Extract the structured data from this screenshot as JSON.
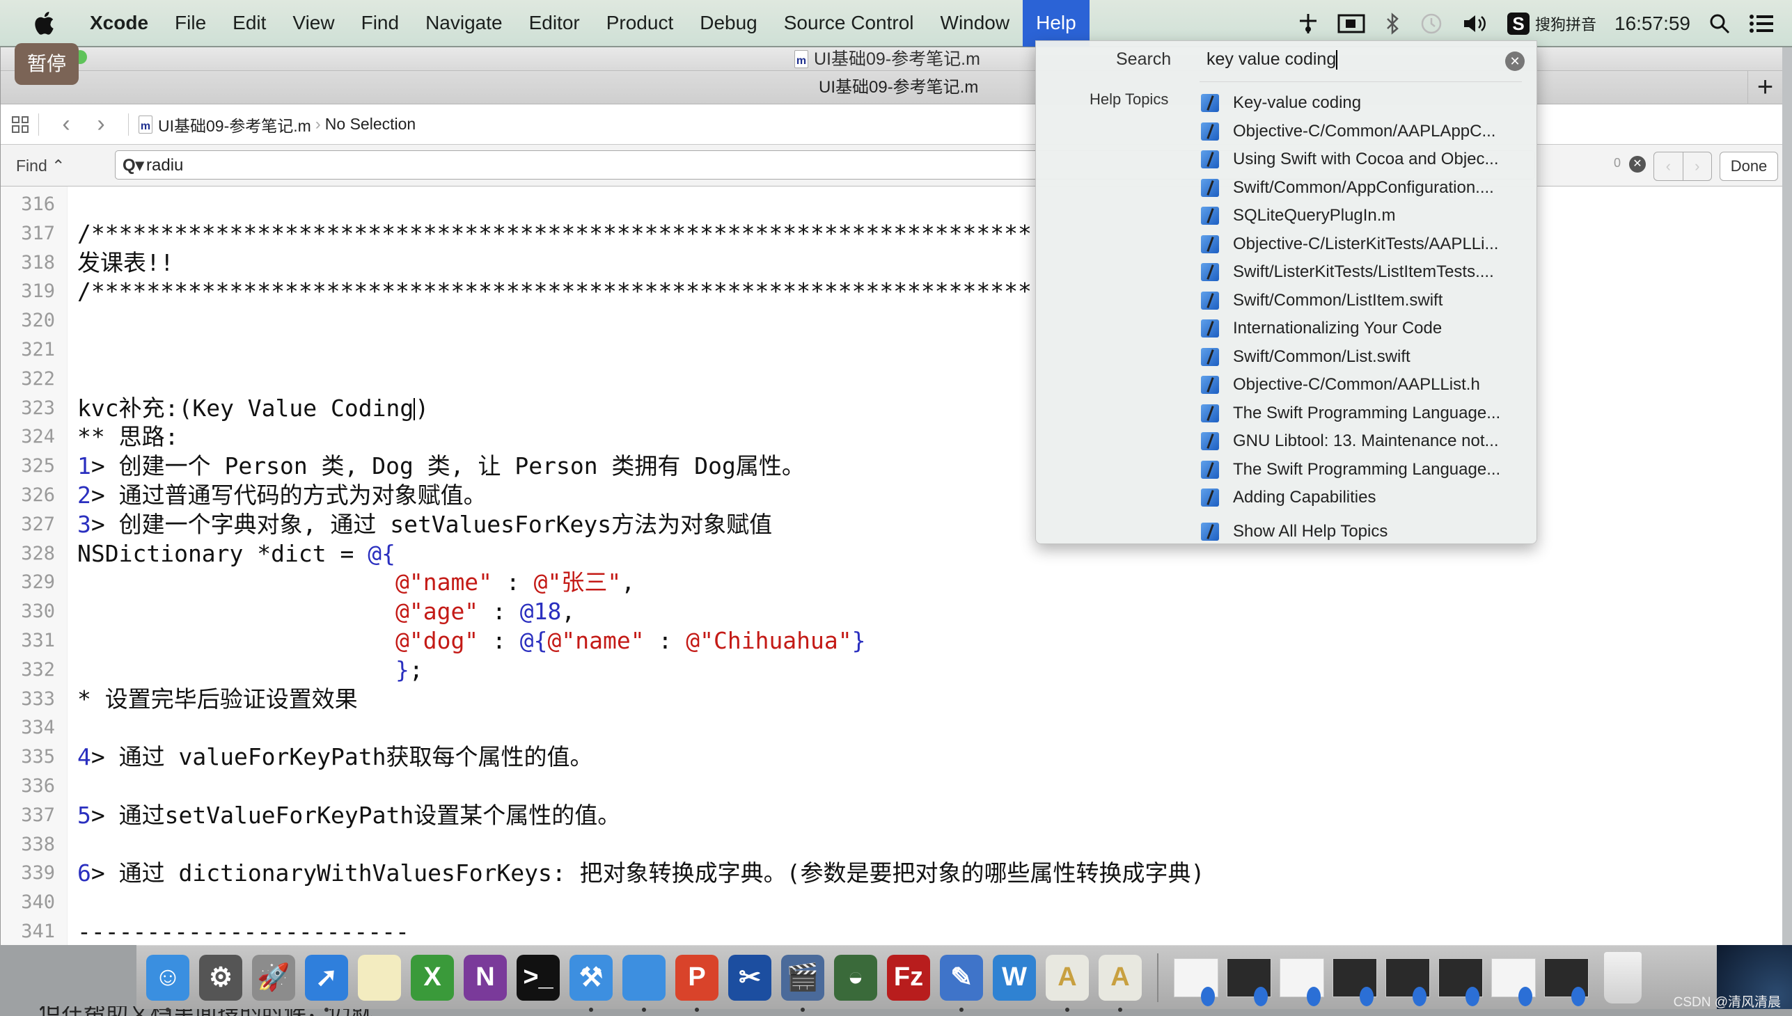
{
  "menubar": {
    "app_name": "Xcode",
    "items": [
      "File",
      "Edit",
      "View",
      "Find",
      "Navigate",
      "Editor",
      "Product",
      "Debug",
      "Source Control",
      "Window",
      "Help"
    ],
    "active_item": "Help",
    "ime_label": "搜狗拼音",
    "clock": "16:57:59"
  },
  "window": {
    "title": "UI基础09-参考笔记.m",
    "tab_title": "UI基础09-参考笔记.m",
    "pause_badge": "暂停",
    "add_tab": "+"
  },
  "jumpbar": {
    "file": "UI基础09-参考笔记.m",
    "selection": "No Selection"
  },
  "findbar": {
    "mode": "Find ⌃",
    "query": "radiu",
    "match_count": "0",
    "done_label": "Done"
  },
  "editor": {
    "lines": [
      {
        "n": "316",
        "t": ""
      },
      {
        "n": "317",
        "t": "/********************************************************************",
        "cls": "c-comment"
      },
      {
        "n": "318",
        "t": "发课表!!"
      },
      {
        "n": "319",
        "t": "/********************************************************************",
        "cls": "c-comment"
      },
      {
        "n": "320",
        "t": ""
      },
      {
        "n": "321",
        "t": ""
      },
      {
        "n": "322",
        "t": ""
      },
      {
        "n": "323",
        "t": "kvc补充:(Key Value Coding)"
      },
      {
        "n": "324",
        "t": "** 思路:"
      },
      {
        "n": "325",
        "num": "1",
        "t": "> 创建一个 Person 类, Dog 类, 让 Person 类拥有 Dog属性。"
      },
      {
        "n": "326",
        "num": "2",
        "t": "> 通过普通写代码的方式为对象赋值。"
      },
      {
        "n": "327",
        "num": "3",
        "t": "> 创建一个字典对象, 通过 setValuesForKeys方法为对象赋值"
      },
      {
        "n": "328",
        "t": "NSDictionary *dict = @{"
      },
      {
        "n": "329",
        "t": "                       @\"name\" : @\"张三\","
      },
      {
        "n": "330",
        "t": "                       @\"age\" : @18,"
      },
      {
        "n": "331",
        "t": "                       @\"dog\" : @{@\"name\" : @\"Chihuahua\"}"
      },
      {
        "n": "332",
        "t": "                       };"
      },
      {
        "n": "333",
        "t": "* 设置完毕后验证设置效果"
      },
      {
        "n": "334",
        "t": ""
      },
      {
        "n": "335",
        "num": "4",
        "t": "> 通过 valueForKeyPath获取每个属性的值。"
      },
      {
        "n": "336",
        "t": ""
      },
      {
        "n": "337",
        "num": "5",
        "t": "> 通过setValueForKeyPath设置某个属性的值。"
      },
      {
        "n": "338",
        "t": ""
      },
      {
        "n": "339",
        "num": "6",
        "t": "> 通过 dictionaryWithValuesForKeys: 把对象转换成字典。(参数是要把对象的哪些属性转换成字典)"
      },
      {
        "n": "340",
        "t": ""
      },
      {
        "n": "341",
        "t": "------------------------"
      }
    ]
  },
  "help_popup": {
    "search_label": "Search",
    "search_value": "key value coding",
    "topics_label": "Help Topics",
    "topics": [
      "Key-value coding",
      "Objective-C/Common/AAPLAppC...",
      "Using Swift with Cocoa and Objec...",
      "Swift/Common/AppConfiguration....",
      "SQLiteQueryPlugIn.m",
      "Objective-C/ListerKitTests/AAPLLi...",
      "Swift/ListerKitTests/ListItemTests....",
      "Swift/Common/ListItem.swift",
      "Internationalizing Your Code",
      "Swift/Common/List.swift",
      "Objective-C/Common/AAPLList.h",
      "The Swift Programming Language...",
      "GNU Libtool: 13. Maintenance not...",
      "The Swift Programming Language...",
      "Adding Capabilities"
    ],
    "show_all": "Show All Help Topics"
  },
  "dock": {
    "apps": [
      {
        "name": "finder",
        "glyph": "☺",
        "color": "#3a8fe0",
        "running": true
      },
      {
        "name": "system-preferences",
        "glyph": "⚙",
        "color": "#555555",
        "running": false
      },
      {
        "name": "launchpad",
        "glyph": "🚀",
        "color": "#8c8c8c",
        "running": false
      },
      {
        "name": "safari",
        "glyph": "➚",
        "color": "#2f7fdc",
        "running": true
      },
      {
        "name": "notes",
        "glyph": "",
        "color": "#f3ecc0",
        "running": false
      },
      {
        "name": "excel",
        "glyph": "X",
        "color": "#3a9a3a",
        "running": false
      },
      {
        "name": "onenote",
        "glyph": "N",
        "color": "#7a3a9a",
        "running": false
      },
      {
        "name": "terminal",
        "glyph": ">_",
        "color": "#111111",
        "running": false
      },
      {
        "name": "xcode",
        "glyph": "⚒",
        "color": "#3d8fe0",
        "running": true
      },
      {
        "name": "folder",
        "glyph": "",
        "color": "#3d8fe0",
        "running": true
      },
      {
        "name": "powerpoint",
        "glyph": "P",
        "color": "#d9432a",
        "running": true
      },
      {
        "name": "screenshot",
        "glyph": "✂",
        "color": "#1c4ea0",
        "running": false
      },
      {
        "name": "video-recorder",
        "glyph": "🎬",
        "color": "#4a6a9a",
        "running": true
      },
      {
        "name": "pro-app",
        "glyph": "◒",
        "color": "#3a6a3a",
        "running": false
      },
      {
        "name": "filezilla",
        "glyph": "Fz",
        "color": "#b81d1d",
        "running": false
      },
      {
        "name": "writing-app",
        "glyph": "✎",
        "color": "#3f74c9",
        "running": true
      },
      {
        "name": "word",
        "glyph": "W",
        "color": "#2f82d2",
        "running": false
      },
      {
        "name": "font-book",
        "glyph": "A",
        "color": "#e8e8e0",
        "running": true
      },
      {
        "name": "text-app",
        "glyph": "A",
        "color": "#e8e8e0",
        "running": true
      }
    ],
    "documents": [
      "light",
      "dark",
      "light",
      "dark",
      "dark",
      "dark",
      "light",
      "dark"
    ],
    "trash": "trash"
  },
  "watermark": "CSDN @清风清晨",
  "subtitle_peek": "但在帮助文档里面搜的时候，仍就"
}
